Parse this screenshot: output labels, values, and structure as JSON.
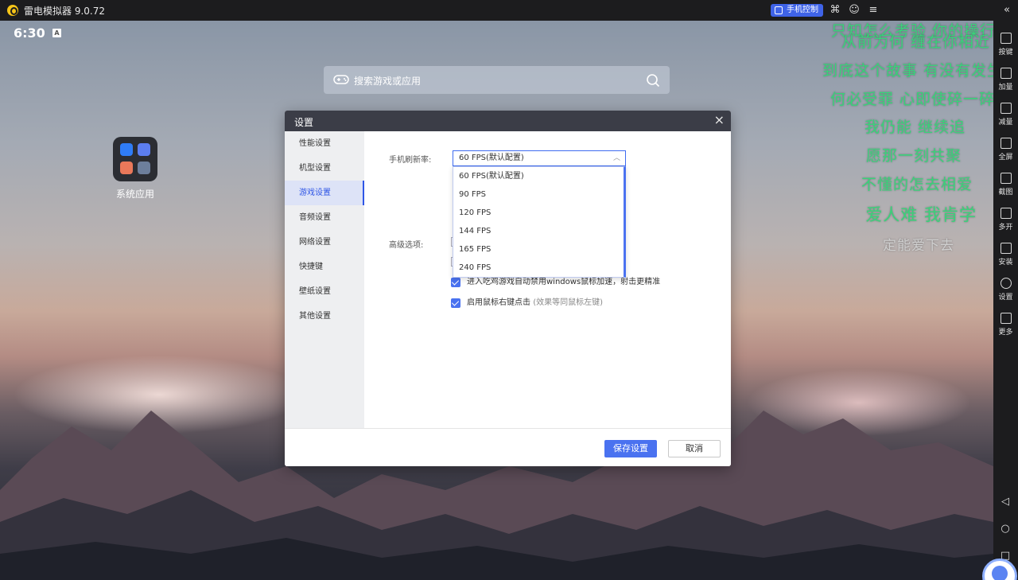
{
  "titlebar": {
    "app_name": "雷电模拟器 9.0.72",
    "phone_control": "手机控制",
    "collapse_glyph": "«"
  },
  "android": {
    "time": "6:30",
    "notification_glyph": "A",
    "search_placeholder": "搜索游戏或应用",
    "folder_label": "系统应用"
  },
  "sidebar": {
    "items": [
      {
        "label": "按键",
        "icon": "keyboard-icon"
      },
      {
        "label": "加量",
        "icon": "volume-up-icon"
      },
      {
        "label": "减量",
        "icon": "volume-down-icon"
      },
      {
        "label": "全屏",
        "icon": "fullscreen-icon"
      },
      {
        "label": "截图",
        "icon": "scissors-icon"
      },
      {
        "label": "多开",
        "icon": "multi-instance-icon"
      },
      {
        "label": "安装",
        "icon": "apk-install-icon"
      },
      {
        "label": "设置",
        "icon": "gear-icon"
      },
      {
        "label": "更多",
        "icon": "more-icon"
      }
    ],
    "nav": {
      "back": "◁",
      "home": "○",
      "recent": "□"
    }
  },
  "lyrics": [
    "只知怎么考验 你的操行",
    "从前为何 缠在你相近",
    "到底这个故事 有没有发生",
    "何必受罪 心即使碎一碎",
    "我仍能 继续追",
    "愿那一刻共聚",
    "不懂的怎去相爱",
    "爱人难 我肯学",
    "定能爱下去"
  ],
  "dialog": {
    "title": "设置",
    "close_glyph": "×",
    "nav": [
      "性能设置",
      "机型设置",
      "游戏设置",
      "音频设置",
      "网络设置",
      "快捷键",
      "壁纸设置",
      "其他设置"
    ],
    "active_nav_index": 2,
    "refresh_label": "手机刷新率:",
    "refresh_selected": "60 FPS(默认配置)",
    "refresh_options": [
      "60 FPS(默认配置)",
      "90 FPS",
      "120 FPS",
      "144 FPS",
      "165 FPS",
      "240 FPS"
    ],
    "advanced_label": "高级选项:",
    "checkboxes": [
      {
        "label": "进入吃鸡游戏自动禁用windows鼠标加速，射击更精准",
        "hint": "",
        "checked": true
      },
      {
        "label": "启用鼠标右键点击",
        "hint": "(效果等同鼠标左键)",
        "checked": true
      }
    ],
    "save_label": "保存设置",
    "cancel_label": "取消"
  },
  "colors": {
    "accent": "#4a72f0",
    "lyric_green": "#3ad27a",
    "dialog_header": "#3b3d47"
  }
}
